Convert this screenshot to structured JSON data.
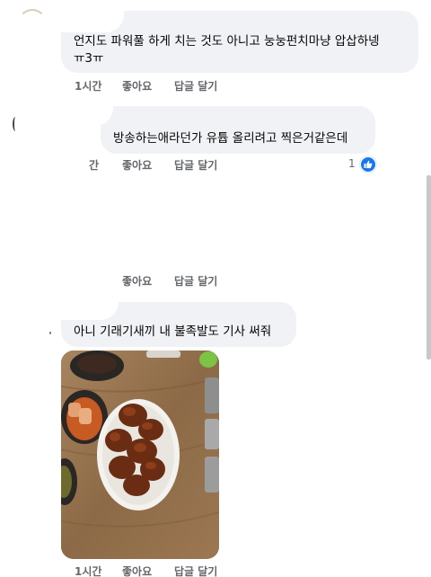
{
  "comments": [
    {
      "text_lines": [
        "언지도 파워풀 하게 치는 것도 아니고 눙눙펀치마냥 압삽하넹",
        "ㅠ3ㅠ"
      ],
      "time": "1시간",
      "like_label": "좋아요",
      "reply_label": "답글 달기"
    },
    {
      "text_lines": [
        "방송하는애라던가 유튭 올리려고 찍은거같은데"
      ],
      "time": "간",
      "like_label": "좋아요",
      "reply_label": "답글 달기",
      "reaction_count": "1"
    },
    {
      "time": "",
      "like_label": "좋아요",
      "reply_label": "답글 달기"
    },
    {
      "text_lines": [
        "아니 기래기새끼 내 불족발도 기사 써줘"
      ],
      "time": "1시간",
      "like_label": "좋아요",
      "reply_label": "답글 달기",
      "photo": "food-photo"
    }
  ],
  "colors": {
    "bubble": "#f0f2f5",
    "meta_text": "#65676b",
    "like_blue": "#1877f2"
  },
  "icons": [
    "like-reaction-icon"
  ]
}
